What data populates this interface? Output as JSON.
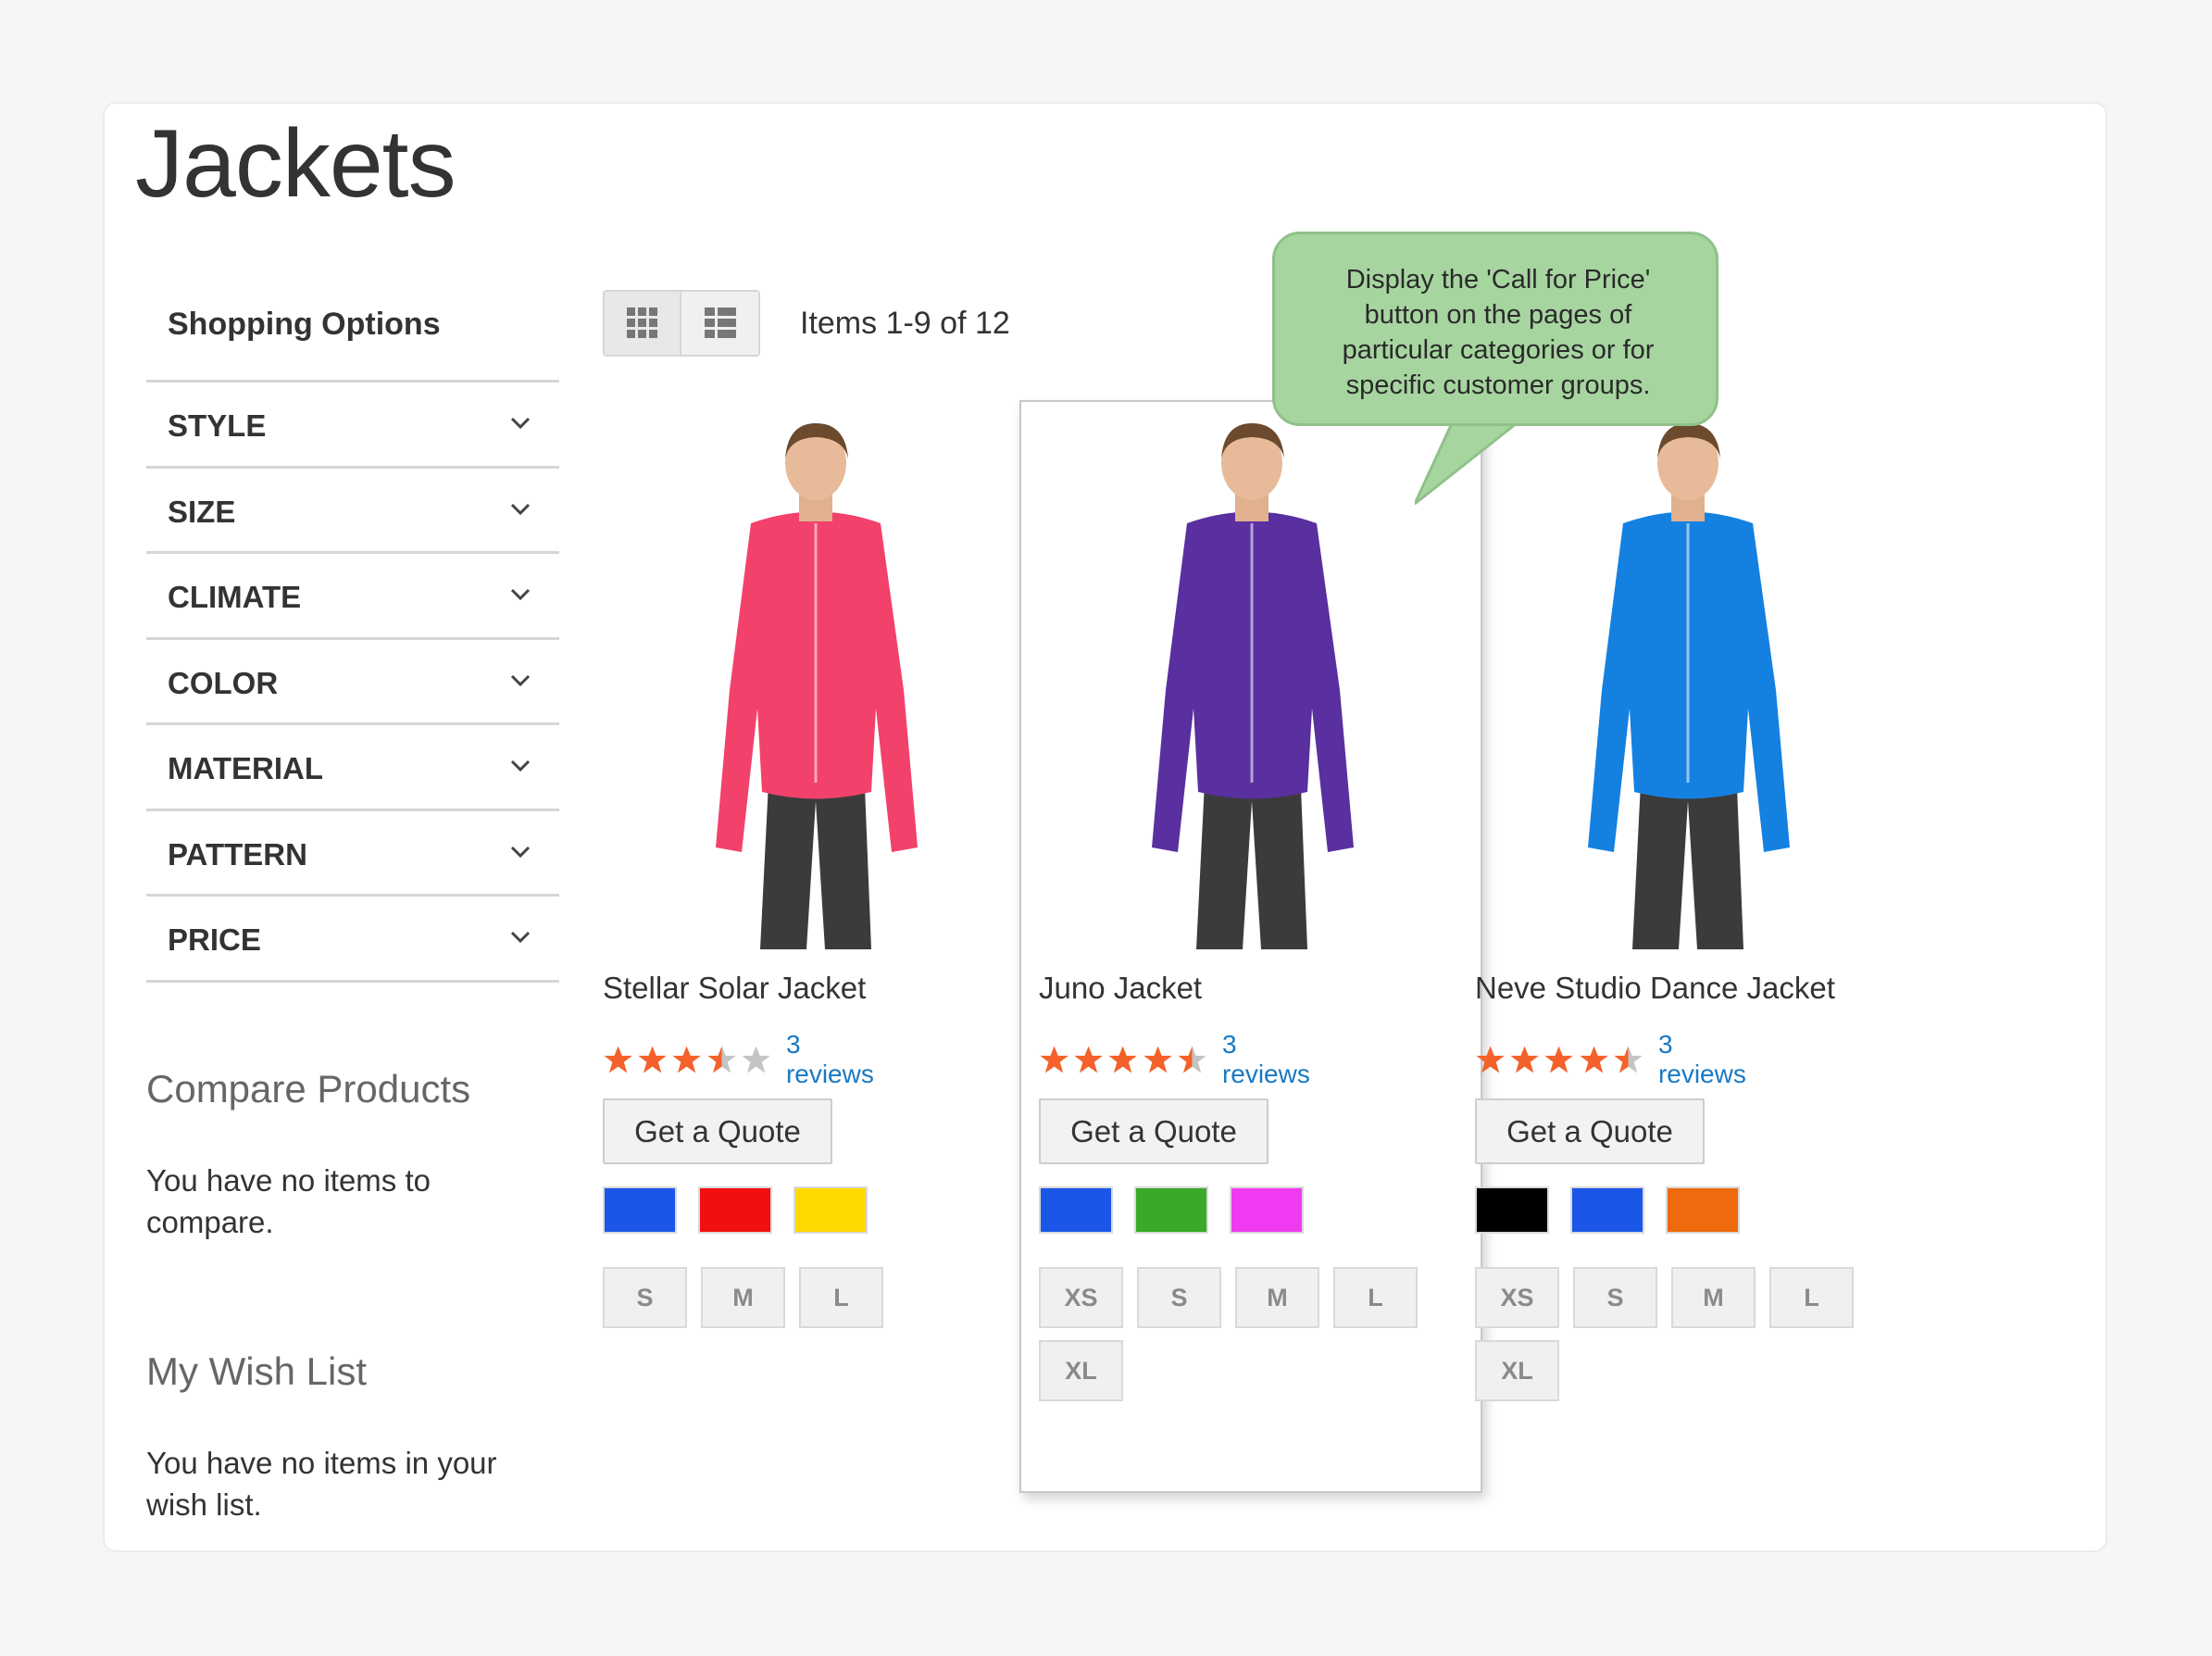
{
  "page": {
    "title": "Jackets"
  },
  "sidebar": {
    "shopping_options_title": "Shopping Options",
    "filters": [
      "STYLE",
      "SIZE",
      "CLIMATE",
      "COLOR",
      "MATERIAL",
      "PATTERN",
      "PRICE"
    ],
    "compare": {
      "title": "Compare Products",
      "empty_text": "You have no items to compare."
    },
    "wishlist": {
      "title": "My Wish List",
      "empty_text": "You have no items in your wish list."
    }
  },
  "toolbar": {
    "view_modes": [
      "grid-view-icon",
      "list-view-icon"
    ],
    "active_mode": "grid",
    "amount": "Items 1-9 of 12"
  },
  "callout": {
    "text": "Display the 'Call for Price' button on the pages of particular categories or for specific customer groups."
  },
  "products": [
    {
      "name": "Stellar Solar Jacket",
      "rating": 3.5,
      "reviews": "3 reviews",
      "button": "Get a Quote",
      "colors": [
        "#1a56e8",
        "#f20f0f",
        "#ffd800"
      ],
      "sizes": [
        "S",
        "M",
        "L"
      ],
      "jacket_color": "#f2416b"
    },
    {
      "name": "Juno Jacket",
      "rating": 4.5,
      "reviews": "3 reviews",
      "button": "Get a Quote",
      "colors": [
        "#1a56e8",
        "#3aa829",
        "#f03af2"
      ],
      "sizes": [
        "XS",
        "S",
        "M",
        "L",
        "XL"
      ],
      "jacket_color": "#5a2fa0"
    },
    {
      "name": "Neve Studio Dance Jacket",
      "rating": 4.5,
      "reviews": "3 reviews",
      "button": "Get a Quote",
      "colors": [
        "#000000",
        "#1a56e8",
        "#ee6a0c"
      ],
      "sizes": [
        "XS",
        "S",
        "M",
        "L",
        "XL"
      ],
      "jacket_color": "#1481e0"
    }
  ],
  "colors": {
    "star": "#f4612a",
    "star_empty": "#c4c4c4",
    "link": "#1979c3",
    "callout": "#a7d5a0"
  }
}
